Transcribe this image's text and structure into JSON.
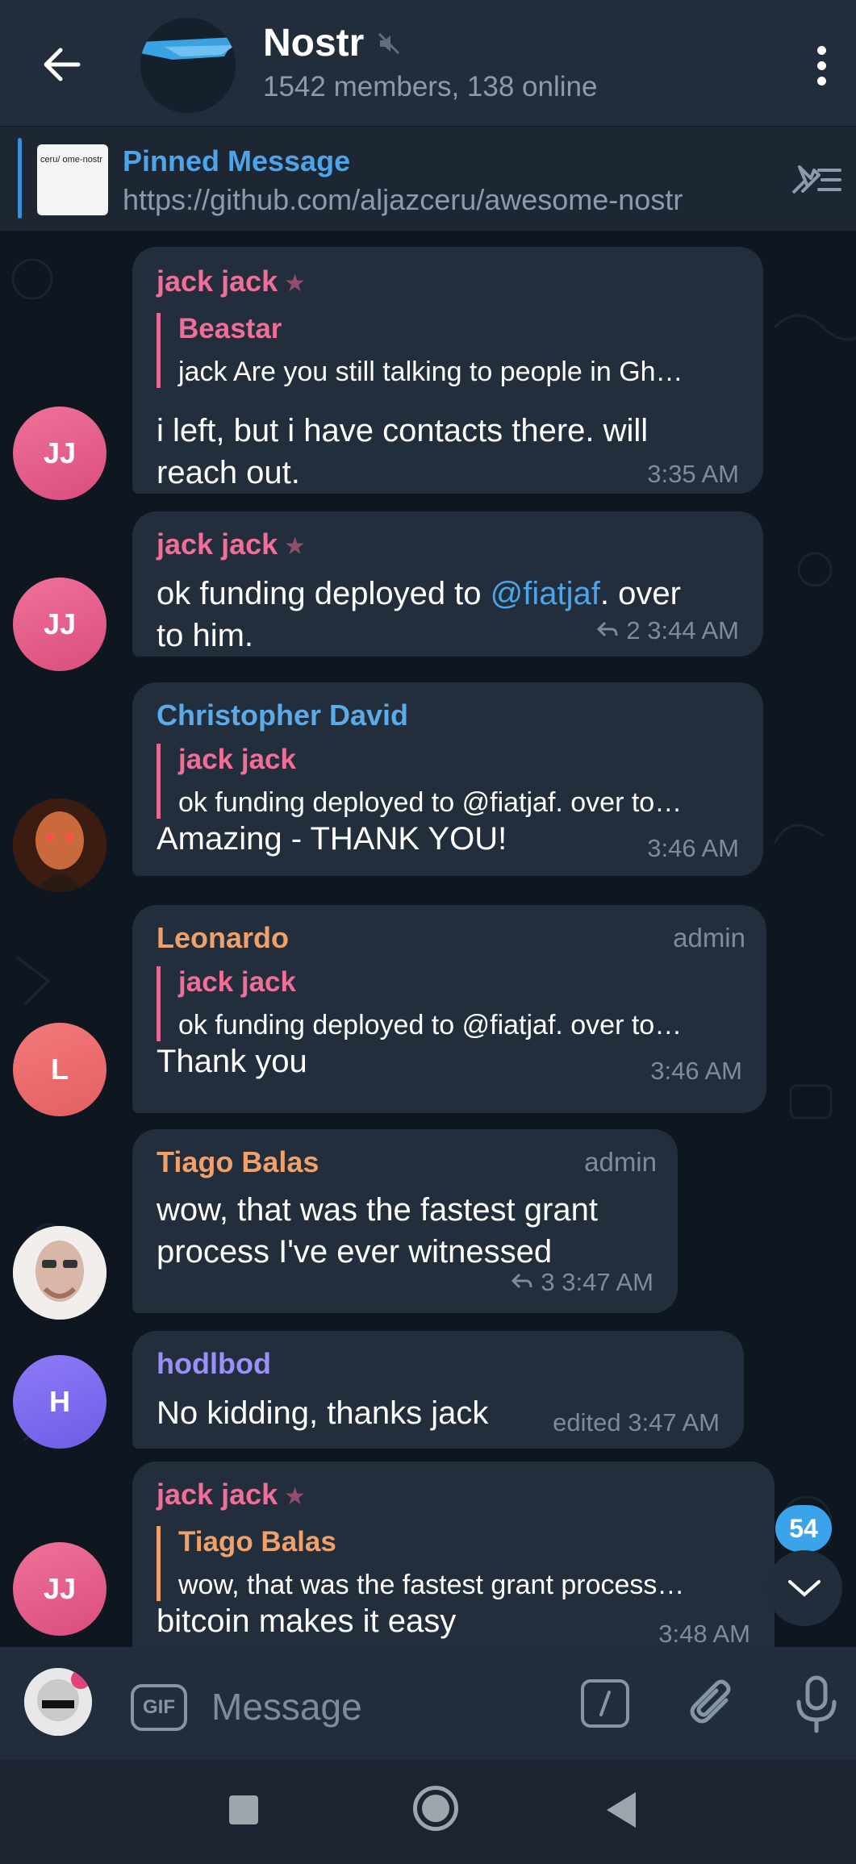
{
  "header": {
    "title": "Nostr",
    "subtitle": "1542 members, 138 online"
  },
  "pinned": {
    "title": "Pinned Message",
    "text": "https://github.com/aljazceru/awesome-nostr",
    "thumb_text": "ceru/ ome-nostr"
  },
  "messages": [
    {
      "sender": "jack jack",
      "avatar": "JJ",
      "reply_name": "Beastar",
      "reply_text": "jack Are you still talking to people in Gh…",
      "text_line1": "i left, but i have contacts there. will",
      "text_line2": "reach out.",
      "time": "3:35 AM"
    },
    {
      "sender": "jack jack",
      "avatar": "JJ",
      "text_pre": "ok funding deployed to ",
      "mention": "@fiatjaf",
      "text_post": ". over",
      "text_line2": "to him.",
      "replies": "2",
      "time": "3:44 AM"
    },
    {
      "sender": "Christopher David",
      "reply_name": "jack jack",
      "reply_text": "ok funding deployed to @fiatjaf. over to…",
      "text": "Amazing - THANK YOU!",
      "time": "3:46 AM"
    },
    {
      "sender": "Leonardo",
      "role": "admin",
      "avatar": "L",
      "reply_name": "jack jack",
      "reply_text": "ok funding deployed to @fiatjaf. over to…",
      "text": "Thank you",
      "time": "3:46 AM"
    },
    {
      "sender": "Tiago Balas",
      "role": "admin",
      "text_line1": "wow, that was the fastest grant",
      "text_line2": "process I've ever witnessed",
      "replies": "3",
      "time": "3:47 AM"
    },
    {
      "sender": "hodlbod",
      "avatar": "H",
      "text": "No kidding, thanks jack",
      "time": "edited 3:47 AM"
    },
    {
      "sender": "jack jack",
      "avatar": "JJ",
      "reply_name": "Tiago Balas",
      "reply_text": "wow, that was the fastest grant process…",
      "text": "bitcoin makes it easy",
      "time": "3:48 AM"
    }
  ],
  "unread_count": "54",
  "input": {
    "placeholder": "Message",
    "gif_label": "GIF"
  },
  "colors": {
    "header_bg": "#212d3b",
    "bubble_bg": "#222e3b",
    "chat_bg": "#0e1620",
    "accent": "#4ea4e8",
    "pink_name": "#f06e97"
  }
}
